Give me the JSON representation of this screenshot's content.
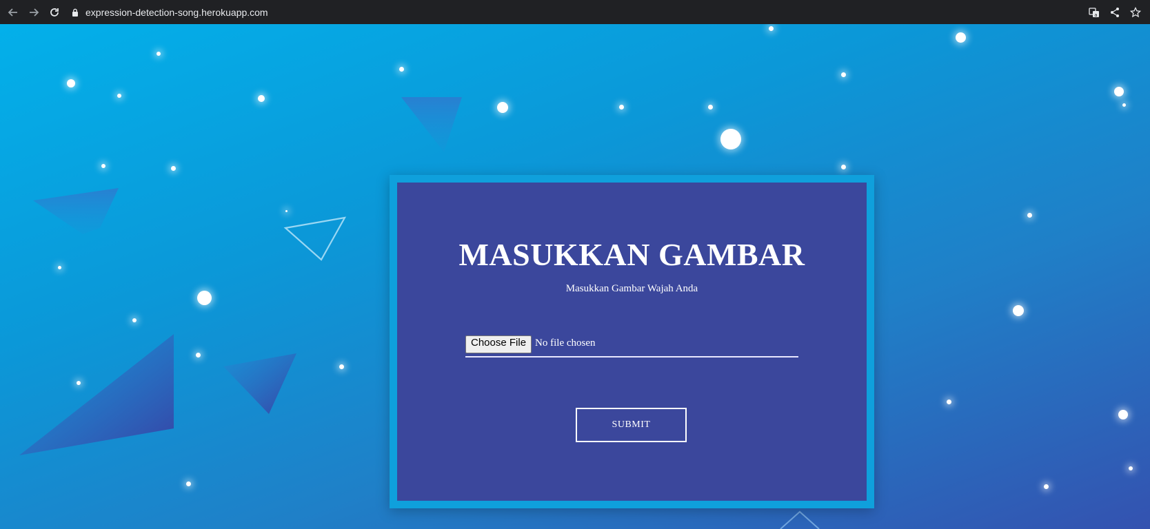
{
  "browser": {
    "url": "expression-detection-song.herokuapp.com",
    "icons": [
      "back-arrow-icon",
      "forward-arrow-icon",
      "reload-icon",
      "lock-icon",
      "translate-icon",
      "share-icon",
      "bookmark-star-icon"
    ]
  },
  "form": {
    "title": "MASUKKAN GAMBAR",
    "subtitle": "Masukkan Gambar Wajah Anda",
    "file_button_label": "Choose File",
    "file_status": "No file chosen",
    "submit_label": "SUBMIT"
  },
  "colors": {
    "card_border": "#0fa0dc",
    "card_background": "#3b479c",
    "page_gradient_start": "#03b0ea",
    "page_gradient_end": "#3452b0",
    "chrome_bar": "#202124"
  }
}
